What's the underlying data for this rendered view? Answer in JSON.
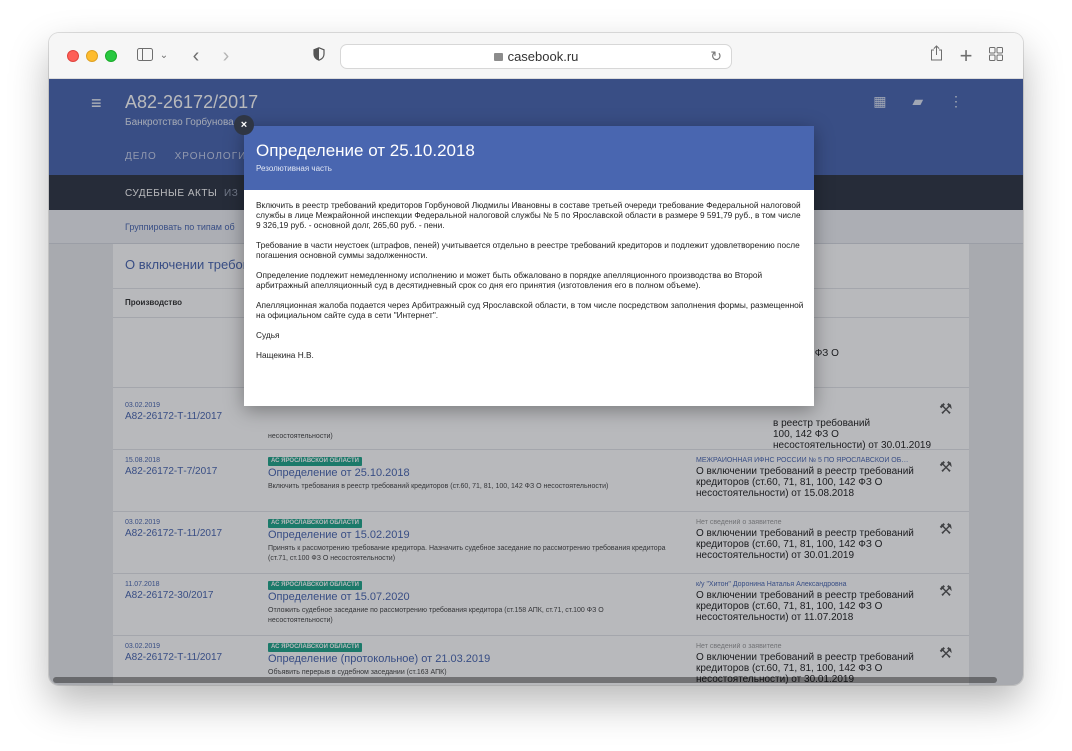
{
  "browser": {
    "url": "casebook.ru"
  },
  "app": {
    "case_number": "А82-26172/2017",
    "case_subtitle": "Банкротство Горбунова",
    "nav_tabs": [
      "ДЕЛО",
      "ХРОНОЛОГИЯ"
    ],
    "sub_tab_active": "СУДЕБНЫЕ АКТЫ",
    "sub_tab_other": "ИЗ",
    "group_link": "Группировать по типам об",
    "section_title": "О включении требова",
    "column_header": "Производство"
  },
  "rows": [
    {
      "date": "",
      "case": "",
      "court": "",
      "doc": "",
      "desc": "",
      "party": "",
      "category": "100, 142 ФЗ О\n01.2019"
    },
    {
      "date": "03.02.2019",
      "case": "А82-26172-Т-11/2017",
      "court": "",
      "doc": "",
      "desc": "несостоятельности)",
      "party": "",
      "category": "в реестр требований\n100, 142 ФЗ О\nнесостоятельности) от 30.01.2019"
    },
    {
      "date": "15.08.2018",
      "case": "А82-26172-Т-7/2017",
      "court": "АС ЯРОСЛАВСКОЙ ОБЛАСТИ",
      "doc": "Определение от 25.10.2018",
      "desc": "Включить требования в реестр требований кредиторов (ст.60, 71, 81, 100, 142 ФЗ О несостоятельности)",
      "party": "МЕЖРАЙОННАЯ ИФНС РОССИИ № 5 ПО ЯРОСЛАВСКОЙ ОБ…",
      "category": "О включении требований в реестр требований кредиторов (ст.60, 71, 81, 100, 142 ФЗ О несостоятельности) от 15.08.2018"
    },
    {
      "date": "03.02.2019",
      "case": "А82-26172-Т-11/2017",
      "court": "АС ЯРОСЛАВСКОЙ ОБЛАСТИ",
      "doc": "Определение от 15.02.2019",
      "desc": "Принять к рассмотрению требование кредитора. Назначить судебное заседание по рассмотрению требования кредитора (ст.71, ст.100 ФЗ О несостоятельности)",
      "party": "Нет сведений о заявителе",
      "category": "О включении требований в реестр требований кредиторов (ст.60, 71, 81, 100, 142 ФЗ О несостоятельности) от 30.01.2019"
    },
    {
      "date": "11.07.2018",
      "case": "А82-26172-30/2017",
      "court": "АС ЯРОСЛАВСКОЙ ОБЛАСТИ",
      "doc": "Определение от 15.07.2020",
      "desc": "Отложить судебное заседание по рассмотрению требования кредитора (ст.158 АПК, ст.71, ст.100 ФЗ О несостоятельности)",
      "party": "к/у \"Хитон\" Доронина Наталья Александровна",
      "category": "О включении требований в реестр требований кредиторов (ст.60, 71, 81, 100, 142 ФЗ О несостоятельности) от 11.07.2018"
    },
    {
      "date": "03.02.2019",
      "case": "А82-26172-Т-11/2017",
      "court": "АС ЯРОСЛАВСКОЙ ОБЛАСТИ",
      "doc": "Определение (протокольное) от 21.03.2019",
      "desc": "Объявить перерыв в судебном заседании (ст.163 АПК)",
      "party": "Нет сведений о заявителе",
      "category": "О включении требований в реестр требований кредиторов (ст.60, 71, 81, 100, 142 ФЗ О несостоятельности) от 30.01.2019"
    }
  ],
  "modal": {
    "title": "Определение от 25.10.2018",
    "subtitle": "Резолютивная часть",
    "close": "×",
    "paragraphs": [
      "Включить в реестр требований кредиторов Горбуновой Людмилы Ивановны в составе третьей очереди требование Федеральной налоговой службы в лице Межрайонной инспекции Федеральной налоговой службы № 5 по Ярославской области в размере 9 591,79 руб., в том числе 9 326,19 руб. - основной долг, 265,60 руб. - пени.",
      "Требование в части неустоек (штрафов, пеней) учитывается отдельно в реестре требований кредиторов и подлежит удовлетворению после погашения основной суммы задолженности.",
      "Определение подлежит немедленному исполнению и может быть обжаловано в порядке апелляционного производства во Второй арбитражный апелляционный суд в десятидневный срок со дня его принятия (изготовления его в полном объеме).",
      "Апелляционная жалоба подается через Арбитражный суд Ярославской области, в том числе посредством заполнения формы, размещенной на официальном сайте суда в сети \"Интернет\".",
      "Судья",
      "Нащекина Н.В."
    ]
  }
}
